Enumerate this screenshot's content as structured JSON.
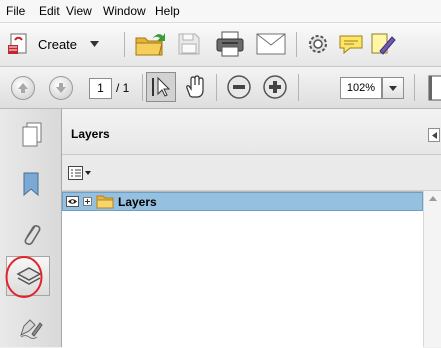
{
  "menubar": {
    "items": [
      "File",
      "Edit",
      "View",
      "Window",
      "Help"
    ]
  },
  "toolbar": {
    "create_label": "Create"
  },
  "navigation": {
    "current_page": "1",
    "page_total": "/ 1"
  },
  "zoom": {
    "value": "102%"
  },
  "panel": {
    "title": "Layers",
    "root_layer_label": "Layers"
  },
  "colors": {
    "selection": "#95c0e0",
    "annotation_circle": "#e0242a",
    "folder": "#f3c64c"
  }
}
